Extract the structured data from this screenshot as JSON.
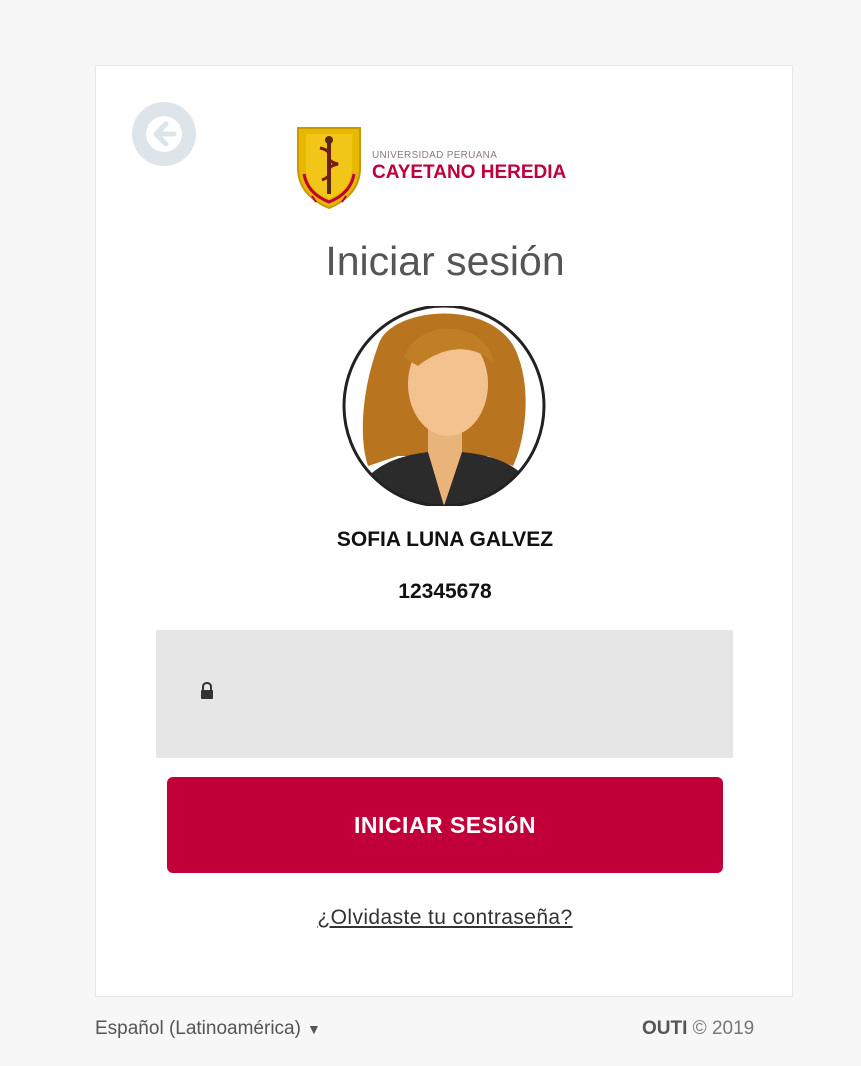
{
  "header": {
    "logo_line1": "UNIVERSIDAD PERUANA",
    "logo_line2": "CAYETANO HEREDIA",
    "back_icon": "arrow-left-icon"
  },
  "login": {
    "title": "Iniciar sesión",
    "user_name": "SOFIA LUNA GALVEZ",
    "user_id": "12345678",
    "password_value": "",
    "lock_icon": "lock-icon",
    "submit_label": "INICIAR SESIóN",
    "forgot_label": "¿Olvidaste tu contraseña?"
  },
  "footer": {
    "language": "Español (Latinoamérica)",
    "brand": "OUTI",
    "copyright": "© 2019"
  },
  "colors": {
    "brand_red": "#c1003a",
    "input_bg": "#e6e6e6",
    "back_btn_bg": "#dde4ea"
  }
}
